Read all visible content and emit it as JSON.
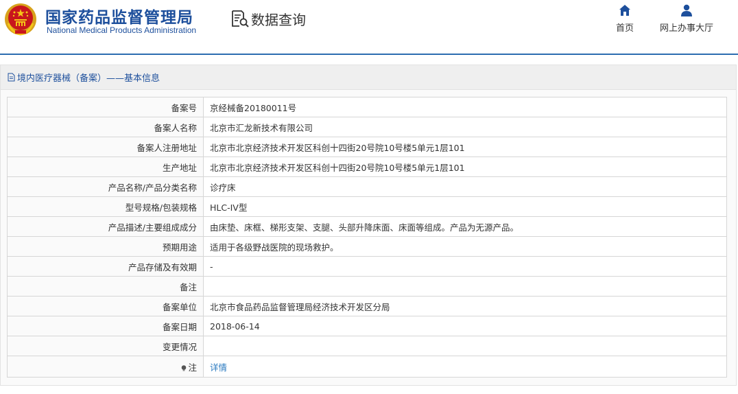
{
  "header": {
    "org_name_cn": "国家药品监督管理局",
    "org_name_en": "National Medical Products Administration",
    "query_title": "数据查询",
    "nav": {
      "home": "首页",
      "hall": "网上办事大厅"
    },
    "accent_color": "#1d4f9c"
  },
  "panel": {
    "title": "境内医疗器械（备案）——基本信息",
    "rows": [
      {
        "label": "备案号",
        "value": "京经械备20180011号"
      },
      {
        "label": "备案人名称",
        "value": "北京市汇龙新技术有限公司"
      },
      {
        "label": "备案人注册地址",
        "value": "北京市北京经济技术开发区科创十四街20号院10号楼5单元1层101"
      },
      {
        "label": "生产地址",
        "value": "北京市北京经济技术开发区科创十四街20号院10号楼5单元1层101"
      },
      {
        "label": "产品名称/产品分类名称",
        "value": "诊疗床"
      },
      {
        "label": "型号规格/包装规格",
        "value": "HLC-IV型"
      },
      {
        "label": "产品描述/主要组成成分",
        "value": "由床垫、床框、梯形支架、支腿、头部升降床面、床面等组成。产品为无源产品。"
      },
      {
        "label": "预期用途",
        "value": "适用于各级野战医院的现场救护。"
      },
      {
        "label": "产品存储及有效期",
        "value": "-"
      },
      {
        "label": "备注",
        "value": ""
      },
      {
        "label": "备案单位",
        "value": "北京市食品药品监督管理局经济技术开发区分局"
      },
      {
        "label": "备案日期",
        "value": "2018-06-14"
      },
      {
        "label": "变更情况",
        "value": ""
      }
    ],
    "note": {
      "label": "注",
      "link": "详情"
    }
  }
}
